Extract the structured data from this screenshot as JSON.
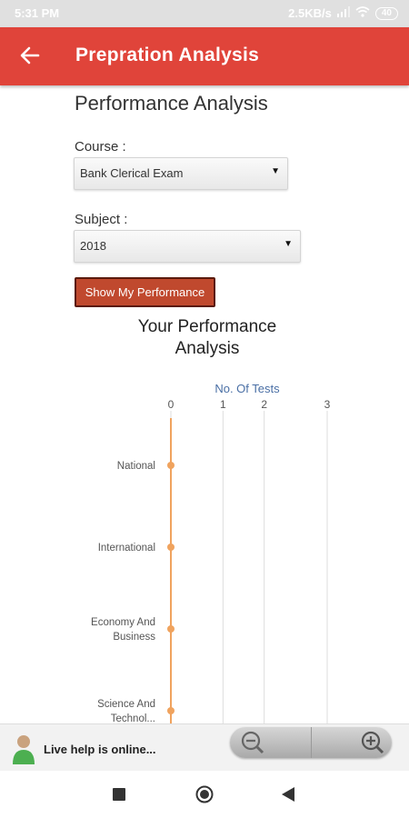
{
  "status": {
    "time": "5:31 PM",
    "net_speed": "2.5KB/s",
    "battery": "40"
  },
  "appbar": {
    "title": "Prepration Analysis"
  },
  "page": {
    "heading": "Performance Analysis"
  },
  "course": {
    "label": "Course :",
    "selected": "Bank Clerical Exam"
  },
  "subject": {
    "label": "Subject :",
    "selected": "2018"
  },
  "show_button": {
    "label": "Show My Performance"
  },
  "chart_title": {
    "line1": "Your Performance",
    "line2": "Analysis"
  },
  "chart_data": {
    "type": "line",
    "orientation": "horizontal",
    "xlabel": "No. Of Tests",
    "xlim": [
      0,
      3
    ],
    "xticks": [
      "0",
      "1",
      "2",
      "3"
    ],
    "categories": [
      "National",
      "International",
      "Economy And Business",
      "Science And Technol..."
    ],
    "values": [
      0,
      0,
      0,
      0
    ],
    "grid": true,
    "colors": {
      "series": "#f0a35e",
      "axis_label": "#4a6fa5",
      "grid": "#dddddd"
    }
  },
  "live_help": {
    "text": "Live help is online..."
  },
  "colors": {
    "accent": "#e0443a",
    "button": "#c0492e"
  }
}
